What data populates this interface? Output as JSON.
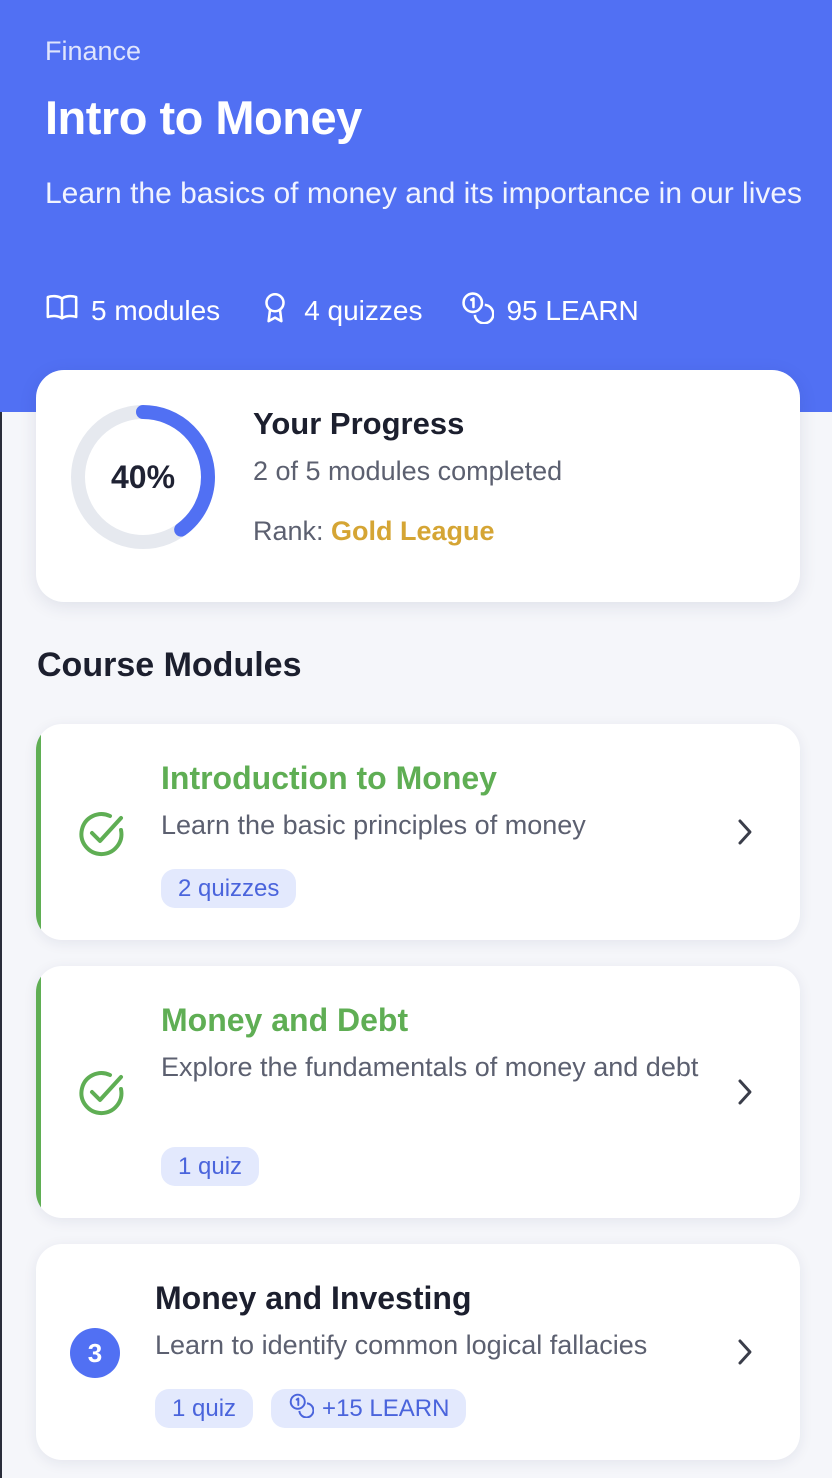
{
  "header": {
    "category": "Finance",
    "title": "Intro to Money",
    "subtitle": "Learn the basics of money and its importance in our lives",
    "stats": {
      "modules": "5 modules",
      "quizzes": "4 quizzes",
      "reward": "95 LEARN"
    }
  },
  "progress": {
    "percent_label": "40%",
    "fraction": 0.4,
    "title": "Your Progress",
    "subtitle": "2 of 5 modules completed",
    "rank_label": "Rank: ",
    "rank_value": "Gold League"
  },
  "modules_section": {
    "title": "Course Modules",
    "modules": [
      {
        "title": "Introduction to Money",
        "description": "Learn the basic principles of money",
        "status": "completed",
        "tags": [
          "2 quizzes"
        ]
      },
      {
        "title": "Money and Debt",
        "description": "Explore the fundamentals of money and debt",
        "status": "completed",
        "tags": [
          "1 quiz"
        ]
      },
      {
        "title": "Money and Investing",
        "description": "Learn to identify common logical fallacies",
        "status": "not-started",
        "step": "3",
        "tags": [
          "1 quiz",
          "+15 LEARN"
        ]
      }
    ]
  },
  "icons": {
    "modules": "book-icon",
    "quizzes": "award-icon",
    "reward": "coins-icon",
    "completed": "check-circle-icon",
    "open": "chevron-right-icon"
  },
  "colors": {
    "brand": "#5170f3",
    "completed": "#5fae54",
    "gold": "#d5a534",
    "tag_bg": "#e3e9fd",
    "tag_text": "#4a64dc"
  }
}
